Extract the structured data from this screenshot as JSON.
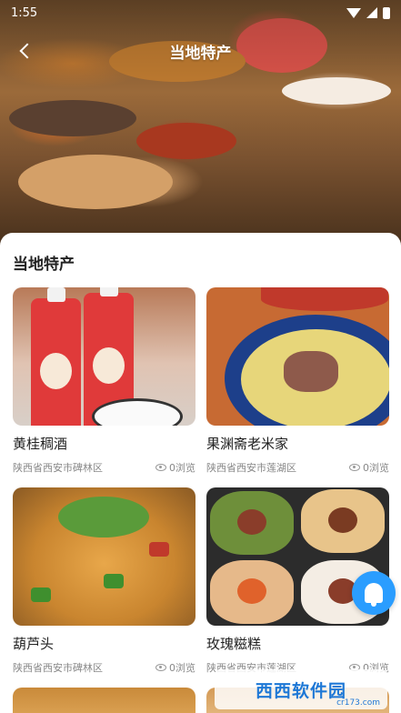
{
  "status_bar": {
    "time": "1:55"
  },
  "nav": {
    "title": "当地特产"
  },
  "section": {
    "title": "当地特产"
  },
  "cards": [
    {
      "name": "黄桂稠酒",
      "location": "陕西省西安市碑林区",
      "views": "0浏览"
    },
    {
      "name": "果渊斋老米家",
      "location": "陕西省西安市莲湖区",
      "views": "0浏览"
    },
    {
      "name": "葫芦头",
      "location": "陕西省西安市碑林区",
      "views": "0浏览"
    },
    {
      "name": "玫瑰糍糕",
      "location": "陕西省西安市莲湖区",
      "views": "0浏览"
    }
  ],
  "watermark": {
    "brand": "西西软件园",
    "site": "cr173.com"
  },
  "colors": {
    "accent": "#2a9dff",
    "watermark": "#1e78d6"
  },
  "icons": [
    "back-icon",
    "wifi-icon",
    "signal-icon",
    "battery-icon",
    "eye-icon",
    "bell-icon"
  ]
}
